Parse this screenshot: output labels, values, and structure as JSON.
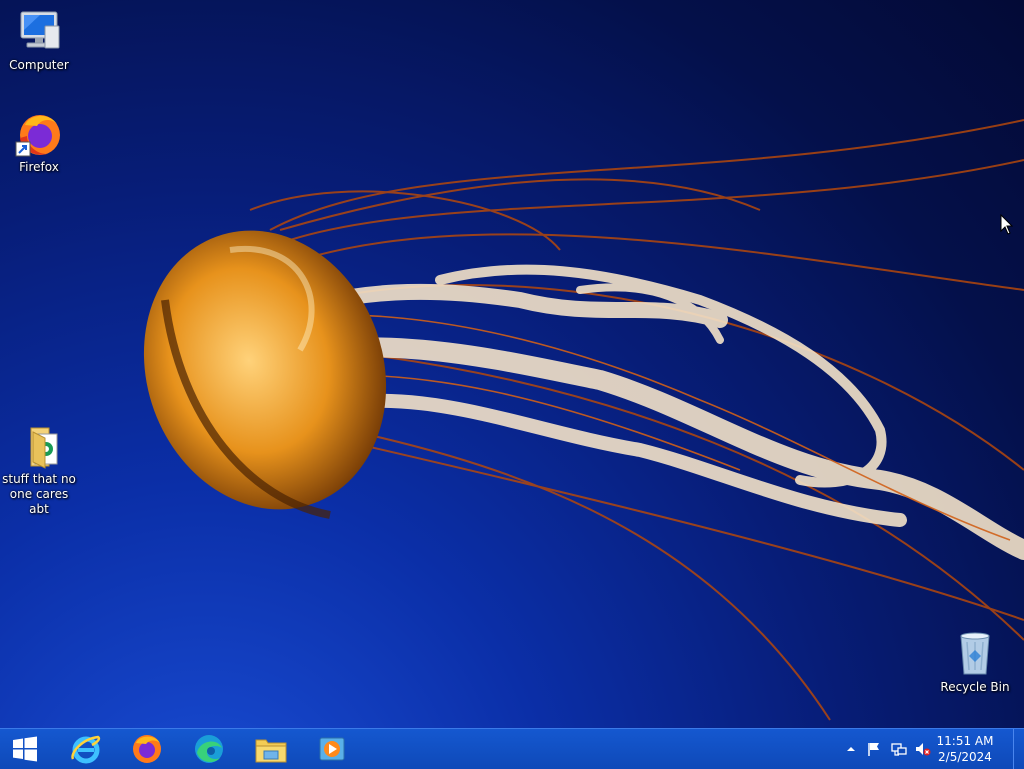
{
  "desktop": {
    "icons": [
      {
        "label": "Computer",
        "icon": "computer-icon"
      },
      {
        "label": "Firefox",
        "icon": "firefox-icon"
      },
      {
        "label": "stuff that no one cares abt",
        "icon": "folder-icon"
      },
      {
        "label": "Recycle Bin",
        "icon": "recycle-bin-icon"
      }
    ]
  },
  "taskbar": {
    "start": {
      "icon": "windows-logo-icon"
    },
    "pinned": [
      {
        "icon": "internet-explorer-icon"
      },
      {
        "icon": "firefox-icon"
      },
      {
        "icon": "edge-icon"
      },
      {
        "icon": "file-explorer-icon"
      },
      {
        "icon": "media-player-icon"
      }
    ],
    "tray": {
      "icons": [
        "show-hidden-icons-arrow",
        "action-center-flag-icon",
        "network-icon",
        "volume-muted-icon"
      ]
    },
    "clock": {
      "time": "11:51 AM",
      "date": "2/5/2024"
    }
  },
  "colors": {
    "taskbar": "#1558d0",
    "wallpaper_bg": "#071d78",
    "jellyfish": "#e08a1a"
  }
}
